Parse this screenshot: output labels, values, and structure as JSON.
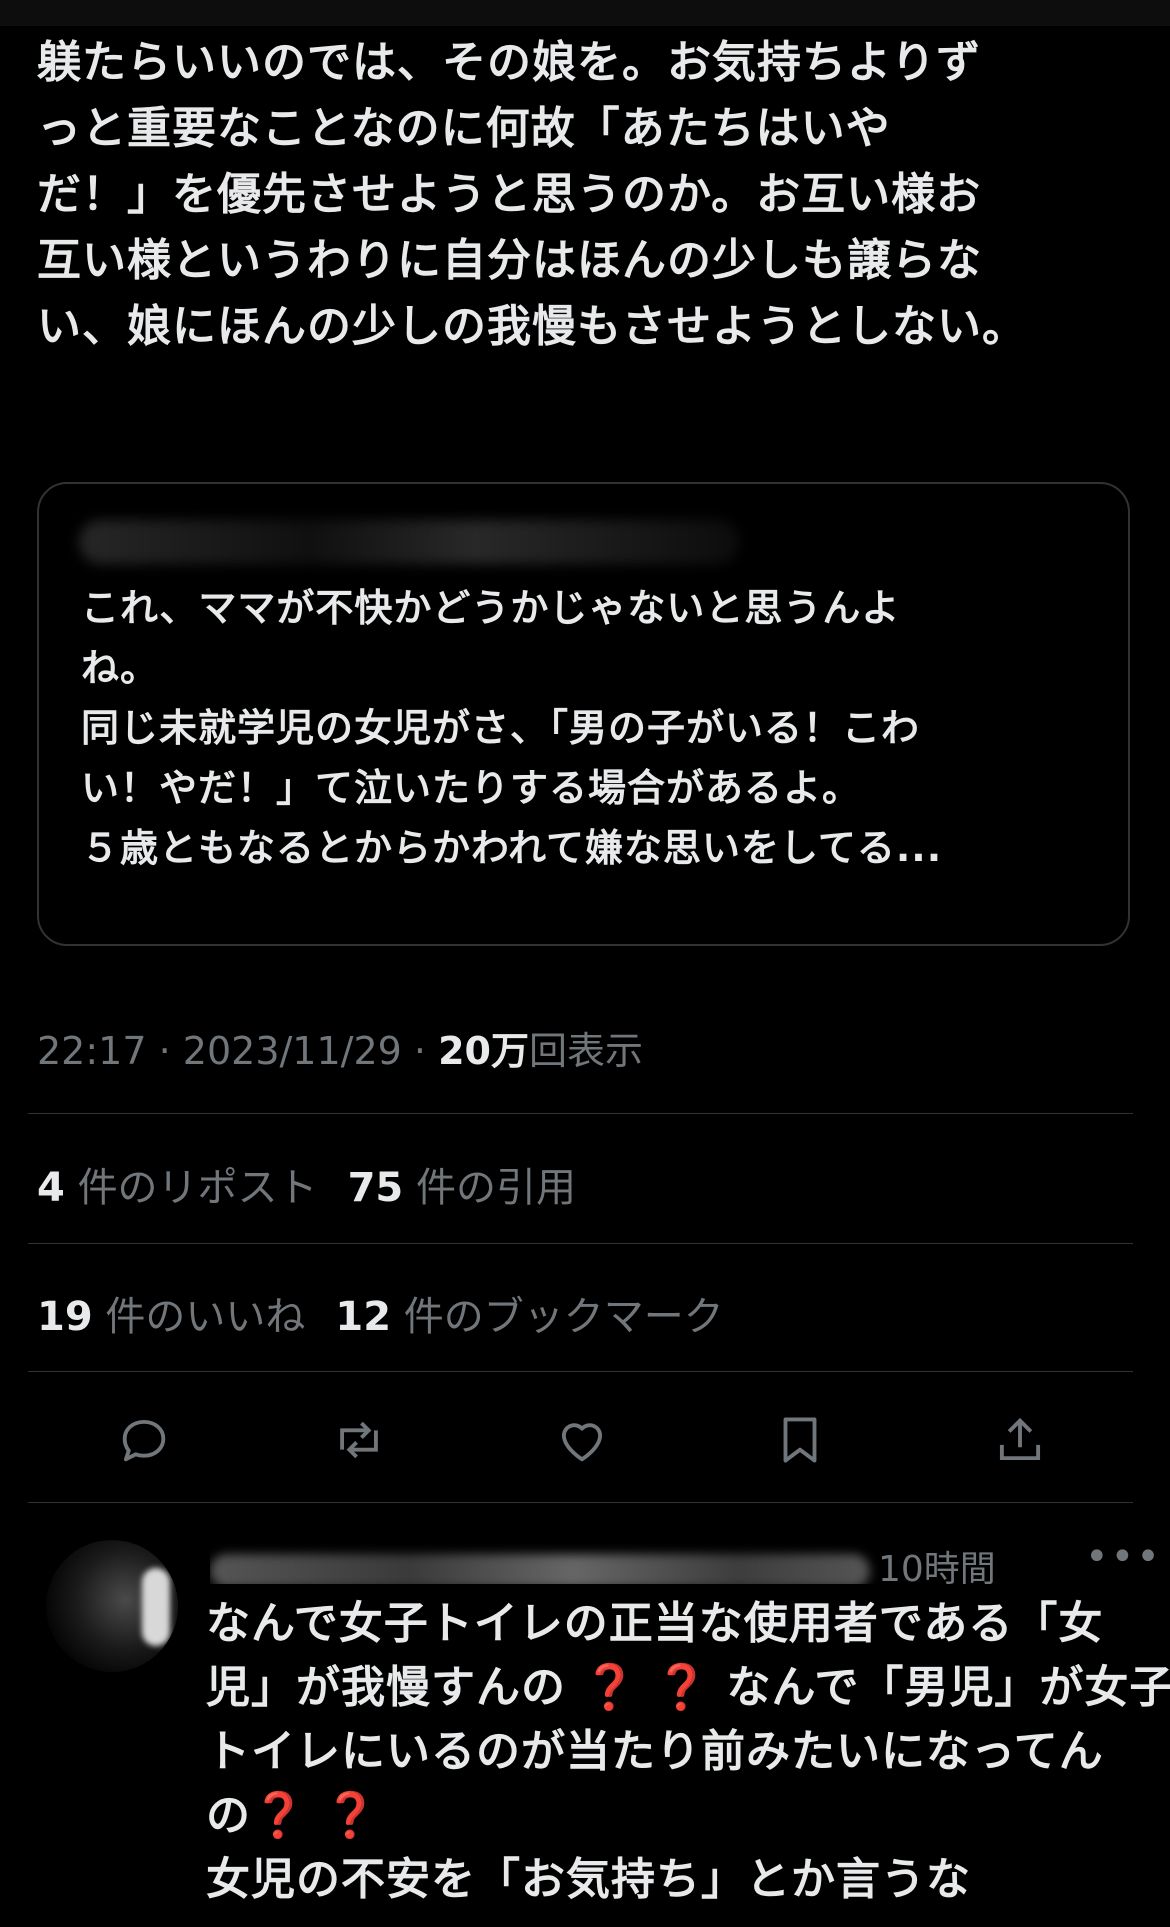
{
  "tweet": {
    "body_lines": [
      "躾たらいいのでは、その娘を。お気持ちよりず",
      "っと重要なことなのに何故「あたちはいや",
      "だ！」を優先させようと思うのか。お互い様お",
      "互い様というわりに自分はほんの少しも譲らな",
      "い、娘にほんの少しの我慢もさせようとしない。"
    ]
  },
  "quote": {
    "text_lines": [
      "これ、ママが不快かどうかじゃないと思うんよ",
      "ね。",
      "同じ未就学児の女児がさ、「男の子がいる！こわ",
      "い！やだ！」て泣いたりする場合があるよ。",
      "５歳ともなるとからかわれて嫌な思いをしてる..."
    ]
  },
  "meta": {
    "time": "22:17",
    "separator": "·",
    "date": "2023/11/29",
    "views_count": "20万",
    "views_label": "回表示"
  },
  "stats": {
    "reposts_count": "4",
    "reposts_label": "件のリポスト",
    "quotes_count": "75",
    "quotes_label": "件の引用",
    "likes_count": "19",
    "likes_label": "件のいいね",
    "bookmarks_count": "12",
    "bookmarks_label": "件のブックマーク"
  },
  "actions": [
    {
      "icon": "reply-icon"
    },
    {
      "icon": "repost-icon"
    },
    {
      "icon": "like-icon"
    },
    {
      "icon": "bookmark-icon"
    },
    {
      "icon": "share-icon"
    }
  ],
  "reply": {
    "time": "10時間",
    "more": "•••",
    "line1": "なんで女子トイレの正当な使用者である「女",
    "line2_a": "児」が我慢すんの",
    "line2_q": "❓ ❓",
    "line2_b": "なんで「男児」が女子",
    "line3": "トイレにいるのが当たり前みたいになってん",
    "line4_a": "の",
    "line4_q": "❓ ❓",
    "line5": "女児の不安を「お気持ち」とか言うな"
  },
  "colors": {
    "background": "#000000",
    "text": "#e7e9ea",
    "secondary": "#71767b",
    "divider": "#2f3336",
    "question_mark": "#e0282c"
  }
}
